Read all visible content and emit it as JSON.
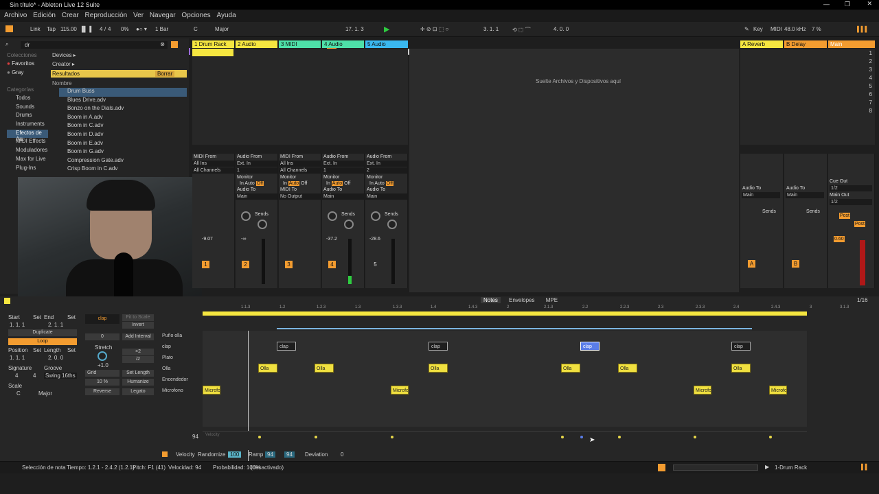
{
  "window": {
    "title": "Sin título* - Ableton Live 12 Suite"
  },
  "menu": [
    "Archivo",
    "Edición",
    "Crear",
    "Reproducción",
    "Ver",
    "Navegar",
    "Opciones",
    "Ayuda"
  ],
  "transport": {
    "link": "Link",
    "tap": "Tap",
    "tempo": "115.00",
    "sig_num": "4",
    "sig_den": "4",
    "cpu": "0%",
    "quant": "1 Bar",
    "key": "C",
    "scale": "Major",
    "position": "17.   1.   3",
    "loop_start": "3.   1.   1",
    "loop_len": "4.   0.   0",
    "key_map": "Key",
    "midi": "MIDI",
    "sample_rate": "48.0 kHz",
    "cpu2": "7 %"
  },
  "browser": {
    "search": "dr",
    "collections_header": "Colecciones",
    "collections": [
      "Favoritos",
      "Gray"
    ],
    "categories_header": "Categorías",
    "categories": [
      "Todos",
      "Sounds",
      "Drums",
      "Instruments",
      "Efectos de Au.",
      "MIDI Effects",
      "Moduladores",
      "Max for Live",
      "Plug-Ins"
    ],
    "crumbs": [
      "Devices ▸",
      "Creator ▸"
    ],
    "results": "Resultados",
    "clear": "Borrar",
    "col_name": "Nombre",
    "items": [
      "Drum Buss",
      "Blues Drive.adv",
      "Bonzo on the Dials.adv",
      "Boom in A.adv",
      "Boom in C.adv",
      "Boom in D.adv",
      "Boom in E.adv",
      "Boom in G.adv",
      "Compression Gate.adv",
      "Crisp Boom in C.adv"
    ]
  },
  "tracks": [
    {
      "name": "1 Drum Rack",
      "color": "#f5e640",
      "num": "1",
      "in_label": "MIDI From",
      "in1": "All Ins",
      "in2": "All Channels",
      "vol": "-9.07"
    },
    {
      "name": "2 Audio",
      "color": "#f5e640",
      "num": "2",
      "in_label": "Audio From",
      "in1": "Ext. In",
      "in2": "1",
      "vol": "-∞"
    },
    {
      "name": "3 MIDI",
      "color": "#4ee0a8",
      "num": "3",
      "in_label": "MIDI From",
      "in1": "All Ins",
      "in2": "All Channels",
      "vol": ""
    },
    {
      "name": "4 Audio",
      "color": "#4ee0a8",
      "num": "4",
      "in_label": "Audio From",
      "in1": "Ext. In",
      "in2": "1",
      "vol": "-37.2"
    },
    {
      "name": "5 Audio",
      "color": "#3ab8f0",
      "num": "5",
      "in_label": "Audio From",
      "in1": "Ext. In",
      "in2": "2",
      "vol": "-28.6"
    }
  ],
  "drop_hint": "Suelte Archivos y Dispositivos aquí",
  "returns": [
    {
      "name": "A Reverb",
      "color": "#f5e640",
      "num": "A"
    },
    {
      "name": "B Delay",
      "color": "#f39c30",
      "num": "B"
    },
    {
      "name": "Main",
      "color": "#f39c30",
      "num": ""
    }
  ],
  "mixer_labels": {
    "monitor": "Monitor",
    "in": "In",
    "auto": "Auto",
    "off": "Off",
    "audio_to": "Audio To",
    "midi_to": "MIDI To",
    "main": "Main",
    "no_output": "No Output",
    "sends": "Sends",
    "cue_out": "Cue Out",
    "main_out": "Main Out",
    "half": "1/2",
    "post": "Post",
    "main_vol": "0.60"
  },
  "scenes": [
    "1",
    "2",
    "3",
    "4",
    "5",
    "6",
    "7",
    "8"
  ],
  "clip": {
    "tabs": [
      "Notes",
      "Envelopes",
      "MPE"
    ],
    "grid_val": "1/16",
    "start": "Start",
    "end": "End",
    "set": "Set",
    "duplicate": "Duplicate",
    "loop": "Loop",
    "position": "Position",
    "length": "Length",
    "signature": "Signature",
    "groove": "Groove",
    "swing": "Swing 16ths",
    "scale": "Scale",
    "scale_key": "C",
    "scale_name": "Major",
    "clip_name": "clap",
    "fit": "Fit to Scale",
    "invert": "Invert",
    "add_interval": "Add Interval",
    "interval_val": "0",
    "stretch": "Stretch",
    "x2": "×2",
    "d2": "/2",
    "grid": "Grid",
    "set_length": "Set Length",
    "humanize": "Humanize",
    "humanize_pct": "10 %",
    "reverse": "Reverse",
    "legato": "Legato",
    "sig_num": "4",
    "sig_den": "4",
    "start_val": "1.   1.   1",
    "end_val": "2.   1.   1",
    "pos_val": "1.   1.   1",
    "len_val": "2.   0.   0",
    "stretch_val": "+1.0"
  },
  "ruler": [
    "1.1.3",
    "1.2",
    "1.2.3",
    "1.3",
    "1.3.3",
    "1.4",
    "1.4.3",
    "2",
    "2.1.3",
    "2.2",
    "2.2.3",
    "2.3",
    "2.3.3",
    "2.4",
    "2.4.3",
    "3",
    "3.1.3"
  ],
  "rows": [
    "Puño olla",
    "clap",
    "Plato",
    "Olla",
    "Encendedor",
    "Microfono"
  ],
  "velocity": {
    "label": "Velocity",
    "value": "94",
    "randomize": "Randomize",
    "rand_val": "100",
    "ramp": "Ramp",
    "ramp1": "94",
    "ramp2": "94",
    "deviation": "Deviation",
    "dev_val": "0"
  },
  "status": {
    "selection": "Selección de nota",
    "tiempo": "Tiempo: 1.2.1 - 2.4.2 (1.2.1)",
    "pitch": "Pitch: F1 (41)",
    "vel": "Velocidad: 94",
    "prob": "Probabilidad: 100%",
    "deact": "(desactivado)",
    "track": "1-Drum Rack"
  }
}
